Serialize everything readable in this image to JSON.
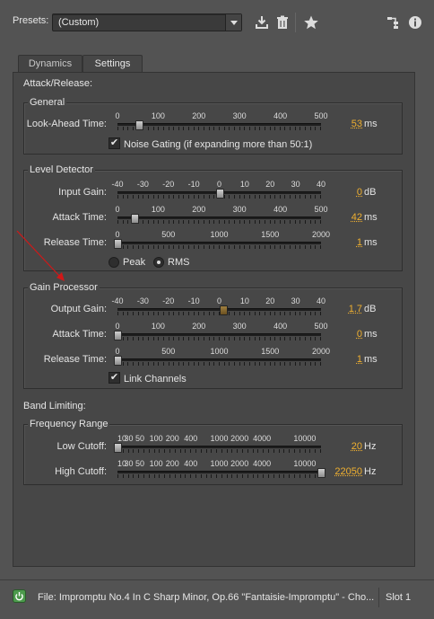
{
  "presets": {
    "label": "Presets:",
    "value": "(Custom)"
  },
  "toolbar": {
    "save_icon": "save-preset-icon",
    "delete_icon": "trash-icon",
    "favorite_icon": "star-icon",
    "routing_icon": "routing-icon",
    "info_icon": "info-icon"
  },
  "tabs": [
    {
      "label": "Dynamics"
    },
    {
      "label": "Settings"
    }
  ],
  "attack_release_heading": "Attack/Release:",
  "general": {
    "title": "General",
    "lookahead": {
      "label": "Look-Ahead Time:",
      "scale": [
        "0",
        "100",
        "200",
        "300",
        "400",
        "500"
      ],
      "value": "53",
      "unit": "ms",
      "fraction": 0.106
    },
    "noise_gating": {
      "label": "Noise Gating (if expanding more than 50:1)",
      "checked": true
    }
  },
  "level_detector": {
    "title": "Level Detector",
    "input_gain": {
      "label": "Input Gain:",
      "scale": [
        "-40",
        "-30",
        "-20",
        "-10",
        "0",
        "10",
        "20",
        "30",
        "40"
      ],
      "value": "0",
      "unit": "dB",
      "fraction": 0.5
    },
    "attack_time": {
      "label": "Attack Time:",
      "scale": [
        "0",
        "100",
        "200",
        "300",
        "400",
        "500"
      ],
      "value": "42",
      "unit": "ms",
      "fraction": 0.084
    },
    "release_time": {
      "label": "Release Time:",
      "scale": [
        "0",
        "500",
        "1000",
        "1500",
        "2000"
      ],
      "value": "1",
      "unit": "ms",
      "fraction": 0.0005
    },
    "mode_peak": "Peak",
    "mode_rms": "RMS",
    "selected_mode": "RMS"
  },
  "gain_processor": {
    "title": "Gain Processor",
    "output_gain": {
      "label": "Output Gain:",
      "scale": [
        "-40",
        "-30",
        "-20",
        "-10",
        "0",
        "10",
        "20",
        "30",
        "40"
      ],
      "value": "1.7",
      "unit": "dB",
      "fraction": 0.521
    },
    "attack_time": {
      "label": "Attack Time:",
      "scale": [
        "0",
        "100",
        "200",
        "300",
        "400",
        "500"
      ],
      "value": "0",
      "unit": "ms",
      "fraction": 0
    },
    "release_time": {
      "label": "Release Time:",
      "scale": [
        "0",
        "500",
        "1000",
        "1500",
        "2000"
      ],
      "value": "1",
      "unit": "ms",
      "fraction": 0.0005
    },
    "link_channels": {
      "label": "Link Channels",
      "checked": true
    }
  },
  "band_limiting_heading": "Band Limiting:",
  "frequency_range": {
    "title": "Frequency Range",
    "scale": [
      "10",
      "30",
      "50",
      "100",
      "200",
      "400",
      "1000",
      "2000",
      "4000",
      "10000"
    ],
    "low_cutoff": {
      "label": "Low Cutoff:",
      "value": "20",
      "unit": "Hz",
      "fraction": 0
    },
    "high_cutoff": {
      "label": "High Cutoff:",
      "value": "22050",
      "unit": "Hz",
      "fraction": 1
    }
  },
  "status": {
    "file": "File: Impromptu No.4 In C Sharp Minor, Op.66 \"Fantaisie-Impromptu\" - Cho...",
    "slot": "Slot 1",
    "power_icon": "power-icon"
  },
  "colors": {
    "value_accent": "#f0b030",
    "annotation_arrow": "#d01818",
    "power_green": "#4c9a4c"
  }
}
